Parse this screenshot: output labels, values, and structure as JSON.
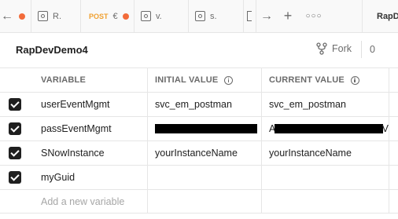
{
  "tabs": [
    {
      "label": "R."
    },
    {
      "method": "POST",
      "label": "€"
    },
    {
      "label": "v."
    },
    {
      "label": "s."
    }
  ],
  "env_label": "RapD",
  "title": "RapDevDemo4",
  "fork": {
    "label": "Fork",
    "count": "0"
  },
  "columns": {
    "variable": "VARIABLE",
    "initial": "INITIAL VALUE",
    "current": "CURRENT VALUE"
  },
  "rows": [
    {
      "name": "userEventMgmt",
      "initial": "svc_em_postman",
      "current": "svc_em_postman",
      "checked": true
    },
    {
      "name": "passEventMgmt",
      "initial": "",
      "current": "A",
      "current_tail": "V",
      "checked": true,
      "redacted": true
    },
    {
      "name": "SNowInstance",
      "initial": "yourInstanceName",
      "current": "yourInstanceName",
      "checked": true
    },
    {
      "name": "myGuid",
      "initial": "",
      "current": "",
      "checked": true
    }
  ],
  "add_placeholder": "Add a new variable"
}
